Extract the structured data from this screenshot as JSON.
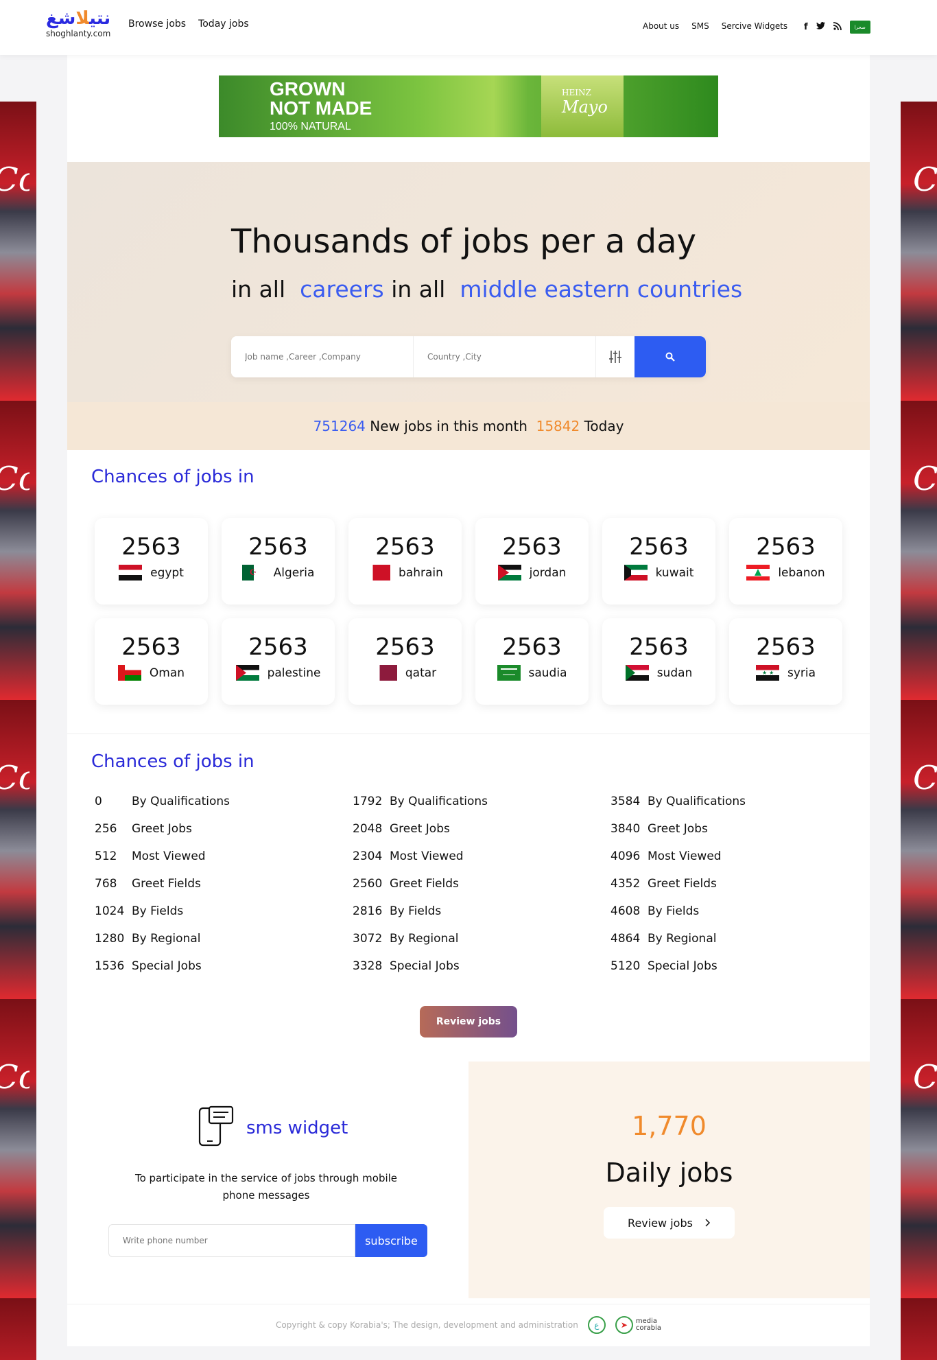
{
  "brand": {
    "arabic_blue": "شغ",
    "arabic_orange": "لا",
    "arabic_tail": "نتي",
    "domain": "shoghlanty.com"
  },
  "nav": {
    "left": [
      "Browse jobs",
      "Today jobs"
    ],
    "right": [
      "About us",
      "SMS",
      "Sercive Widgets"
    ],
    "social_icons": [
      "facebook-icon",
      "twitter-icon",
      "rss-icon"
    ],
    "flag_label": "صحرا"
  },
  "ad_banner": {
    "line1": "GROWN",
    "line2": "NOT MADE",
    "line3": "100% NATURAL",
    "brand": "Mayo",
    "brand_top": "HEINZ"
  },
  "side_ad": {
    "brand": "Coca-Cola"
  },
  "hero": {
    "title": "Thousands of jobs per a day",
    "sub_1": "in all",
    "sub_2": "careers",
    "sub_3": "in all",
    "sub_4": "middle eastern countries",
    "search_placeholder": "Job name ,Career ,Company",
    "location_placeholder": "Country ,City"
  },
  "stats": {
    "month_count": "751264",
    "month_label": "New jobs in this month",
    "today_count": "15842",
    "today_label": "Today"
  },
  "countries_title": "Chances of jobs in",
  "countries": [
    {
      "count": "2563",
      "name": "egypt"
    },
    {
      "count": "2563",
      "name": "Algeria"
    },
    {
      "count": "2563",
      "name": "bahrain"
    },
    {
      "count": "2563",
      "name": "jordan"
    },
    {
      "count": "2563",
      "name": "kuwait"
    },
    {
      "count": "2563",
      "name": "lebanon"
    },
    {
      "count": "2563",
      "name": "Oman"
    },
    {
      "count": "2563",
      "name": "palestine"
    },
    {
      "count": "2563",
      "name": "qatar"
    },
    {
      "count": "2563",
      "name": "saudia"
    },
    {
      "count": "2563",
      "name": "sudan"
    },
    {
      "count": "2563",
      "name": "syria"
    }
  ],
  "lists_title": "Chances of jobs in",
  "lists": [
    [
      {
        "n": "0",
        "label": "By Qualifications"
      },
      {
        "n": "256",
        "label": "Greet Jobs"
      },
      {
        "n": "512",
        "label": "Most Viewed"
      },
      {
        "n": "768",
        "label": "Greet Fields"
      },
      {
        "n": "1024",
        "label": "By Fields"
      },
      {
        "n": "1280",
        "label": "By Regional"
      },
      {
        "n": "1536",
        "label": "Special Jobs"
      }
    ],
    [
      {
        "n": "1792",
        "label": "By Qualifications"
      },
      {
        "n": "2048",
        "label": "Greet Jobs"
      },
      {
        "n": "2304",
        "label": "Most Viewed"
      },
      {
        "n": "2560",
        "label": "Greet Fields"
      },
      {
        "n": "2816",
        "label": "By Fields"
      },
      {
        "n": "3072",
        "label": "By Regional"
      },
      {
        "n": "3328",
        "label": "Special Jobs"
      }
    ],
    [
      {
        "n": "3584",
        "label": "By Qualifications"
      },
      {
        "n": "3840",
        "label": "Greet Jobs"
      },
      {
        "n": "4096",
        "label": "Most Viewed"
      },
      {
        "n": "4352",
        "label": "Greet Fields"
      },
      {
        "n": "4608",
        "label": "By Fields"
      },
      {
        "n": "4864",
        "label": "By Regional"
      },
      {
        "n": "5120",
        "label": "Special Jobs"
      }
    ]
  ],
  "review_button": "Review jobs",
  "sms": {
    "title": "sms widget",
    "description": "To participate in the service of jobs through mobile phone messages",
    "placeholder": "Write phone number",
    "button": "subscribe"
  },
  "daily": {
    "count": "1,770",
    "label": "Daily jobs",
    "button": "Review jobs"
  },
  "footer": {
    "text": "Copyright & copy Korabia's; The design, development and administration",
    "logo2_line1": "media",
    "logo2_line2": "corabia"
  },
  "colors": {
    "accent_blue": "#2d5cf2",
    "title_blue": "#2a2ad8",
    "accent_orange": "#f08a2c"
  }
}
